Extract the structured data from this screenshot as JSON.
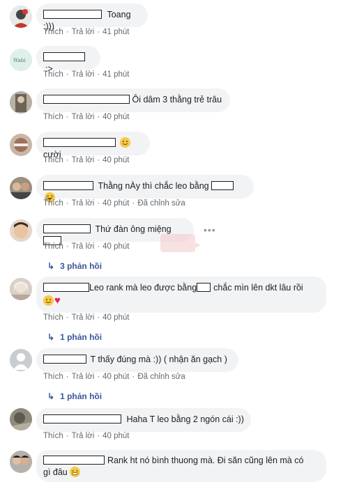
{
  "actions": {
    "like": "Thích",
    "reply": "Trả lời",
    "edited": "Đã chỉnh sửa",
    "dot": "·"
  },
  "comments": [
    {
      "text": "Toang :)))",
      "time": "41 phút"
    },
    {
      "text": ":>",
      "time": "41 phút"
    },
    {
      "text": "Ôi dâm 3 thằng trẻ trâu",
      "time": "40 phút"
    },
    {
      "text": "cười",
      "time": "40 phút"
    },
    {
      "text": "Thằng nÀy thì chắc leo bằng",
      "time": "40 phút",
      "edited": true
    },
    {
      "text": "Thứ đàn ông miệng",
      "time": "40 phút"
    },
    {
      "text": "Leo rank mà leo được bằng",
      "text2": "chắc mìn lên dkt lâu rồi",
      "time": "40 phút"
    },
    {
      "text": "T thấy đúng mà :)) ( nhận ăn gạch )",
      "time": "40 phút",
      "edited": true
    },
    {
      "text": "Haha T leo bằng 2 ngón cái :))",
      "time": "40 phút"
    },
    {
      "text": "Rank ht nó bình thuong mà. Đi săn cũng lên mà có",
      "text2": "gì đâu"
    }
  ],
  "replies": [
    "3 phản hồi",
    "1 phản hồi",
    "1 phản hồi"
  ],
  "icons": {
    "reply_arrow": "reply-arrow-icon",
    "more": "more-options-icon"
  }
}
